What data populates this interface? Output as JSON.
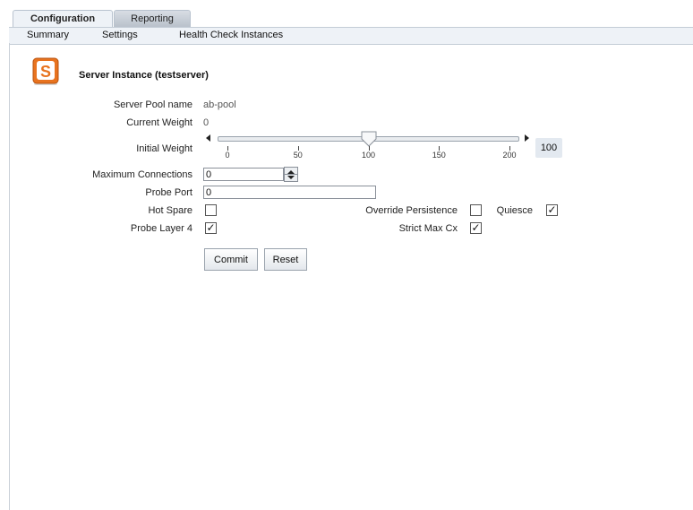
{
  "tabs": [
    {
      "label": "Configuration",
      "active": true
    },
    {
      "label": "Reporting",
      "active": false
    }
  ],
  "subnav": [
    "Summary",
    "Settings",
    "Health Check Instances"
  ],
  "header": {
    "title": "Server Instance (testserver)",
    "icon": "server-s-icon",
    "icon_letter": "S",
    "accent": "#e8731f"
  },
  "fields": {
    "server_pool_label": "Server Pool name",
    "server_pool_value": "ab-pool",
    "current_weight_label": "Current Weight",
    "current_weight_value": "0",
    "initial_weight_label": "Initial Weight",
    "max_conn_label": "Maximum Connections",
    "max_conn_value": "0",
    "probe_port_label": "Probe Port",
    "probe_port_value": "0",
    "hot_spare_label": "Hot Spare",
    "override_persistence_label": "Override Persistence",
    "quiesce_label": "Quiesce",
    "probe_layer4_label": "Probe Layer 4",
    "strict_max_cx_label": "Strict Max Cx"
  },
  "checkboxes": {
    "hot_spare": false,
    "override_persistence": false,
    "quiesce": true,
    "probe_layer4": true,
    "strict_max_cx": true
  },
  "slider": {
    "min": 0,
    "max": 200,
    "value": 100,
    "value_display": "100",
    "ticks": [
      "0",
      "50",
      "100",
      "150",
      "200"
    ]
  },
  "buttons": {
    "commit": "Commit",
    "reset": "Reset"
  }
}
